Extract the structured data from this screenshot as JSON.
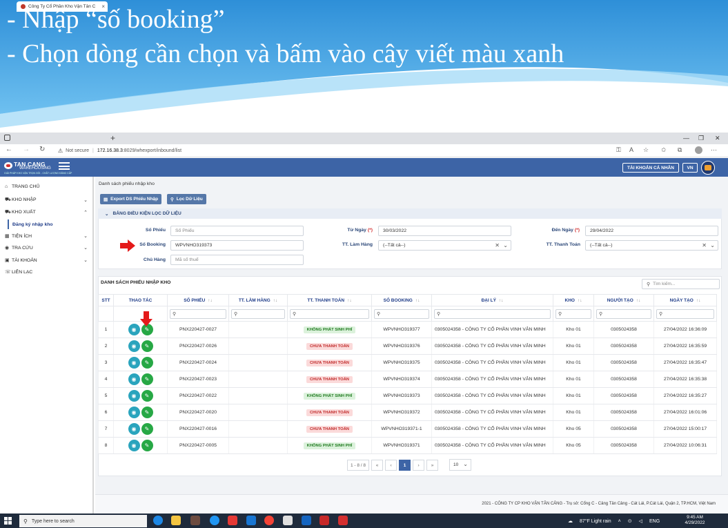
{
  "slide": {
    "line1": "- Nhập “số booking”",
    "line2": "- Chọn dòng cần chọn và bấm vào cây viết màu xanh"
  },
  "browser": {
    "tab_title": "Công Ty Cổ Phần Kho Vận Tân C",
    "tab_close": "×",
    "new_tab": "+",
    "security": "Not secure",
    "url_host": "172.16.38.3",
    "url_rest": ":8029/whexport/inbound/list",
    "back": "←",
    "forward": "→",
    "reload": "↻",
    "minimize": "—",
    "restore": "❐",
    "close": "✕"
  },
  "app": {
    "logo_line1": "TAN CANG",
    "logo_line2": "WAREHOUSING",
    "logo_tagline": "GIẢI PHÁP KHO VẬN TRỌN GÓI - CHẤT LƯỢNG ĐẲNG CẤP",
    "account_button": "TÀI KHOẢN CÁ NHÂN",
    "lang_button": "VN"
  },
  "sidebar": {
    "items": [
      {
        "icon": "home-icon",
        "glyph": "⌂",
        "label": "TRANG CHỦ",
        "chev": ""
      },
      {
        "icon": "truck-in-icon",
        "glyph": "⛟",
        "label": "KHO NHẬP",
        "chev": "⌄"
      },
      {
        "icon": "truck-out-icon",
        "glyph": "⛟",
        "label": "KHO XUẤT",
        "chev": "⌃"
      },
      {
        "icon": "grid-icon",
        "glyph": "▦",
        "label": "TIỆN ÍCH",
        "chev": "⌄"
      },
      {
        "icon": "globe-icon",
        "glyph": "◉",
        "label": "TRA CỨU",
        "chev": "⌄"
      },
      {
        "icon": "user-icon",
        "glyph": "▣",
        "label": "TÀI KHOẢN",
        "chev": "⌄"
      },
      {
        "icon": "phone-icon",
        "glyph": "☏",
        "label": "LIÊN LẠC",
        "chev": ""
      }
    ],
    "active_sub": "Đăng ký nhập kho"
  },
  "page": {
    "breadcrumb": "Danh sách phiếu nhập kho",
    "export_button": "Export DS Phiếu Nhập",
    "filter_button": "Lọc Dữ Liệu"
  },
  "filter": {
    "header": "BẢNG ĐIỀU KIỆN LỌC DỮ LIỆU",
    "so_phieu_label": "Số Phiếu",
    "so_phieu_placeholder": "Số Phiếu",
    "so_booking_label": "Số Booking",
    "so_booking_value": "WPVNHO319373",
    "chu_hang_label": "Chủ Hàng",
    "chu_hang_placeholder": "Mã số thuế",
    "tu_ngay_label": "Từ Ngày",
    "tu_ngay_value": "30/03/2022",
    "tt_lam_hang_label": "TT. Làm Hàng",
    "tt_lam_hang_value": "(--Tất cả--)",
    "den_ngay_label": "Đến Ngày",
    "den_ngay_value": "29/04/2022",
    "tt_thanh_toan_label": "TT. Thanh Toán",
    "tt_thanh_toan_value": "(--Tất cả--)",
    "required_mark": "(*)"
  },
  "list": {
    "title": "DANH SÁCH PHIẾU NHẬP KHO",
    "search_placeholder": "Tìm kiếm...",
    "columns": [
      "STT",
      "THAO TÁC",
      "SỐ PHIẾU",
      "TT. LÀM HÀNG",
      "TT. THANH TOÁN",
      "SỐ BOOKING",
      "ĐẠI LÝ",
      "KHO",
      "NGƯỜI TẠO",
      "NGÀY TẠO"
    ],
    "rows": [
      {
        "stt": "1",
        "so_phieu": "PNX220427-0027",
        "tt_lam_hang": "",
        "tt_thanh_toan": "KHÔNG PHÁT SINH PHÍ",
        "status": "green",
        "booking": "WPVNHO319377",
        "dai_ly": "0305024358 - CÔNG TY CỔ PHẦN VINH VÂN MINH",
        "kho": "Kho 01",
        "nguoi_tao": "0305024358",
        "ngay_tao": "27/04/2022 16:36:09"
      },
      {
        "stt": "2",
        "so_phieu": "PNX220427-0026",
        "tt_lam_hang": "",
        "tt_thanh_toan": "CHƯA THANH TOÁN",
        "status": "red",
        "booking": "WPVNHO319376",
        "dai_ly": "0305024358 - CÔNG TY CỔ PHẦN VINH VÂN MINH",
        "kho": "Kho 01",
        "nguoi_tao": "0305024358",
        "ngay_tao": "27/04/2022 16:35:59"
      },
      {
        "stt": "3",
        "so_phieu": "PNX220427-0024",
        "tt_lam_hang": "",
        "tt_thanh_toan": "CHƯA THANH TOÁN",
        "status": "red",
        "booking": "WPVNHO319375",
        "dai_ly": "0305024358 - CÔNG TY CỔ PHẦN VINH VÂN MINH",
        "kho": "Kho 01",
        "nguoi_tao": "0305024358",
        "ngay_tao": "27/04/2022 16:35:47"
      },
      {
        "stt": "4",
        "so_phieu": "PNX220427-0023",
        "tt_lam_hang": "",
        "tt_thanh_toan": "CHƯA THANH TOÁN",
        "status": "red",
        "booking": "WPVNHO319374",
        "dai_ly": "0305024358 - CÔNG TY CỔ PHẦN VINH VÂN MINH",
        "kho": "Kho 01",
        "nguoi_tao": "0305024358",
        "ngay_tao": "27/04/2022 16:35:38"
      },
      {
        "stt": "5",
        "so_phieu": "PNX220427-0022",
        "tt_lam_hang": "",
        "tt_thanh_toan": "KHÔNG PHÁT SINH PHÍ",
        "status": "green",
        "booking": "WPVNHO319373",
        "dai_ly": "0305024358 - CÔNG TY CỔ PHẦN VINH VÂN MINH",
        "kho": "Kho 01",
        "nguoi_tao": "0305024358",
        "ngay_tao": "27/04/2022 16:35:27"
      },
      {
        "stt": "6",
        "so_phieu": "PNX220427-0020",
        "tt_lam_hang": "",
        "tt_thanh_toan": "CHƯA THANH TOÁN",
        "status": "red",
        "booking": "WPVNHO319372",
        "dai_ly": "0305024358 - CÔNG TY CỔ PHẦN VINH VÂN MINH",
        "kho": "Kho 01",
        "nguoi_tao": "0305024358",
        "ngay_tao": "27/04/2022 16:01:06"
      },
      {
        "stt": "7",
        "so_phieu": "PNX220427-0016",
        "tt_lam_hang": "",
        "tt_thanh_toan": "CHƯA THANH TOÁN",
        "status": "red",
        "booking": "WPVNHO319371-1",
        "dai_ly": "0305024358 - CÔNG TY CỔ PHẦN VINH VÂN MINH",
        "kho": "Kho 05",
        "nguoi_tao": "0305024358",
        "ngay_tao": "27/04/2022 15:00:17"
      },
      {
        "stt": "8",
        "so_phieu": "PNX220427-0005",
        "tt_lam_hang": "",
        "tt_thanh_toan": "KHÔNG PHÁT SINH PHÍ",
        "status": "green",
        "booking": "WPVNHO319371",
        "dai_ly": "0305024358 - CÔNG TY CỔ PHẦN VINH VÂN MINH",
        "kho": "Kho 05",
        "nguoi_tao": "0305024358",
        "ngay_tao": "27/04/2022 10:06:31"
      }
    ]
  },
  "pagination": {
    "range": "1 - 8 / 8",
    "first": "«",
    "prev": "‹",
    "current": "1",
    "next": "›",
    "last": "»",
    "page_size": "10"
  },
  "footer": {
    "text": "2021 - CÔNG TY CP KHO VẬN TÂN CẢNG - Trụ sở: Cổng C - Cảng Tân Cảng - Cát Lái, P.Cát Lái, Quận 2, TP.HCM, Việt Nam"
  },
  "taskbar": {
    "search_placeholder": "Type here to search",
    "weather": "87°F  Light rain",
    "lang": "ENG",
    "time": "9:45 AM",
    "date": "4/29/2022"
  },
  "colors": {
    "header_blue": "#3d64a6",
    "paid_green": "#27a845",
    "view_teal": "#2aa4bd",
    "unpaid_red": "#c02a2a",
    "annotation_red": "#e41a1a"
  }
}
